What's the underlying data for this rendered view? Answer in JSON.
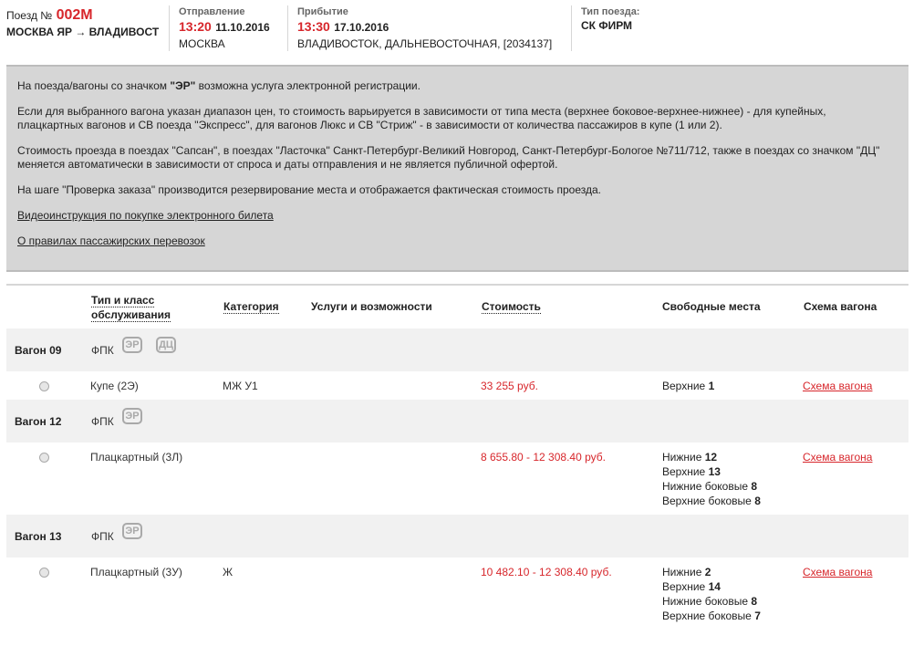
{
  "header": {
    "train_label": "Поезд №",
    "train_number": "002М",
    "route": "МОСКВА ЯР → ВЛАДИВОСТ",
    "departure": {
      "label": "Отправление",
      "time": "13:20",
      "date": "11.10.2016",
      "station": "МОСКВА"
    },
    "arrival": {
      "label": "Прибытие",
      "time": "13:30",
      "date": "17.10.2016",
      "station": "ВЛАДИВОСТОК, ДАЛЬНЕВОСТОЧНАЯ, [2034137]"
    },
    "train_type": {
      "label": "Тип поезда:",
      "value": "СК ФИРМ"
    }
  },
  "info": {
    "p1_pre": "На поезда/вагоны со значком ",
    "p1_bold": "\"ЭР\"",
    "p1_post": " возможна услуга электронной регистрации.",
    "p2_line1": "Если для выбранного вагона указан диапазон цен, то стоимость варьируется в зависимости от типа места (верхнее боковое-верхнее-нижнее) - для купейных,",
    "p2_line2": "плацкартных вагонов и СВ поезда \"Экспресс\", для вагонов Люкс и СВ \"Стриж\" - в зависимости от количества пассажиров в купе (1 или 2).",
    "p3_line1": "Стоимость проезда в поездах \"Сапсан\", в поездах \"Ласточка\" Санкт-Петербург-Великий Новгород, Санкт-Петербург-Бологое №711/712, также в поездах со значком \"ДЦ\"",
    "p3_line2": "меняется автоматически в зависимости от спроса и даты отправления и не является публичной офертой.",
    "p4": "На шаге \"Проверка заказа\" производится резервирование места и отображается фактическая стоимость проезда.",
    "link_video": "Видеоинструкция по покупке электронного билета",
    "link_rules": "О правилах пассажирских перевозок"
  },
  "table": {
    "col_type_line1": "Тип и класс",
    "col_type_line2": "обслуживания",
    "col_category": "Категория",
    "col_services": "Услуги и возможности",
    "col_cost": "Стоимость",
    "col_free": "Свободные места",
    "col_scheme": "Схема вагона"
  },
  "wagons": [
    {
      "title": "Вагон 09",
      "carrier": "ФПК",
      "badge1": "ЭР",
      "badge2": "ДЦ",
      "type": "Купе (2Э)",
      "category": "МЖ У1",
      "price": "33 255 руб.",
      "seats": [
        {
          "label": "Верхние",
          "count": "1"
        }
      ],
      "scheme": "Схема вагона"
    },
    {
      "title": "Вагон 12",
      "carrier": "ФПК",
      "badge1": "ЭР",
      "type": "Плацкартный (3Л)",
      "category": "",
      "price": "8 655.80 - 12 308.40 руб.",
      "seats": [
        {
          "label": "Нижние",
          "count": "12"
        },
        {
          "label": "Верхние",
          "count": "13"
        },
        {
          "label": "Нижние боковые",
          "count": "8"
        },
        {
          "label": "Верхние боковые",
          "count": "8"
        }
      ],
      "scheme": "Схема вагона"
    },
    {
      "title": "Вагон 13",
      "carrier": "ФПК",
      "badge1": "ЭР",
      "type": "Плацкартный (3У)",
      "category": "Ж",
      "price": "10 482.10 - 12 308.40 руб.",
      "seats": [
        {
          "label": "Нижние",
          "count": "2"
        },
        {
          "label": "Верхние",
          "count": "14"
        },
        {
          "label": "Нижние боковые",
          "count": "8"
        },
        {
          "label": "Верхние боковые",
          "count": "7"
        }
      ],
      "scheme": "Схема вагона"
    }
  ]
}
